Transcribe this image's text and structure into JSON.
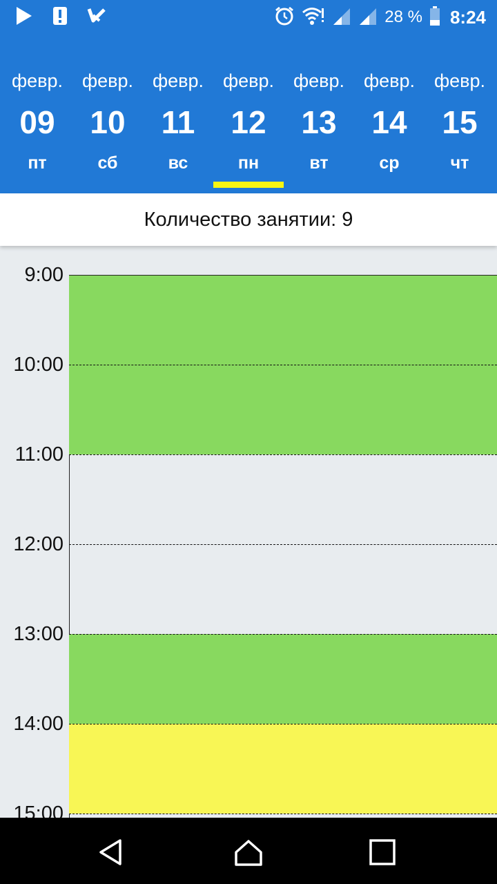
{
  "status_bar": {
    "battery_percent": "28 %",
    "time": "8:24",
    "icons_left": [
      "play-icon",
      "alert-icon",
      "checkmark-app-icon"
    ],
    "icons_right": [
      "alarm-icon",
      "wifi-icon",
      "signal-icon",
      "signal-icon",
      "battery-icon"
    ]
  },
  "days": [
    {
      "month": "февр.",
      "day": "09",
      "weekday": "пт",
      "selected": false
    },
    {
      "month": "февр.",
      "day": "10",
      "weekday": "сб",
      "selected": false
    },
    {
      "month": "февр.",
      "day": "11",
      "weekday": "вс",
      "selected": false
    },
    {
      "month": "февр.",
      "day": "12",
      "weekday": "пн",
      "selected": true
    },
    {
      "month": "февр.",
      "day": "13",
      "weekday": "вт",
      "selected": false
    },
    {
      "month": "февр.",
      "day": "14",
      "weekday": "ср",
      "selected": false
    },
    {
      "month": "февр.",
      "day": "15",
      "weekday": "чт",
      "selected": false
    }
  ],
  "lessons_count_text": "Количество занятии: 9",
  "schedule": {
    "hours": [
      "9:00",
      "10:00",
      "11:00",
      "12:00",
      "13:00",
      "14:00",
      "15:00"
    ],
    "blocks": [
      {
        "start": "9:00",
        "end": "11:00",
        "color": "#88d95f"
      },
      {
        "start": "13:00",
        "end": "14:00",
        "color": "#88d95f"
      },
      {
        "start": "14:00",
        "end": "15:00",
        "color": "#f8f655"
      }
    ]
  },
  "colors": {
    "header": "#2179d6",
    "indicator": "#f8f512",
    "lesson_green": "#88d95f",
    "lesson_yellow": "#f8f655",
    "background": "#e8ecef"
  },
  "nav": [
    "back-icon",
    "home-icon",
    "recents-icon"
  ]
}
